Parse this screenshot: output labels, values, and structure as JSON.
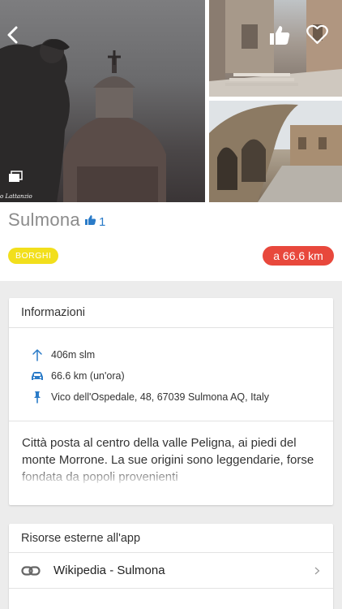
{
  "gallery": {
    "photo_credit": "o Lattanzio"
  },
  "place": {
    "title": "Sulmona",
    "likes": "1",
    "category": "BORGHI",
    "distance": "a 66.6 km"
  },
  "info": {
    "header": "Informazioni",
    "altitude": "406m slm",
    "travel": "66.6 km (un'ora)",
    "address": "Vico dell'Ospedale, 48, 67039 Sulmona AQ, Italy",
    "description": "Città posta al centro della valle Peligna, ai piedi del monte Morrone. La sue origini sono leggendarie, forse fondata da popoli provenienti"
  },
  "external": {
    "header": "Risorse esterne all'app",
    "items": [
      {
        "label": "Wikipedia - Sulmona"
      }
    ]
  },
  "colors": {
    "accent_blue": "#2a7bc8",
    "badge_yellow": "#f2df1c",
    "badge_red": "#e8483c"
  },
  "icons": [
    "back-icon",
    "gallery-icon",
    "like-icon",
    "heart-icon",
    "arrow-up-icon",
    "car-icon",
    "pin-icon",
    "link-icon",
    "chevron-right-icon"
  ]
}
